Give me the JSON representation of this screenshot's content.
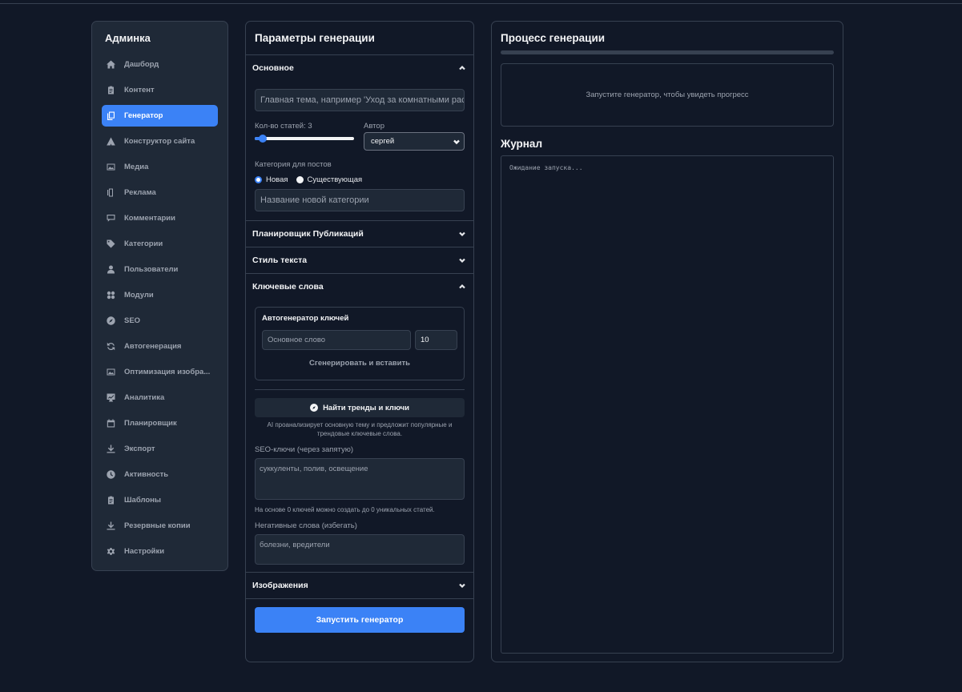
{
  "sidebar": {
    "title": "Админка",
    "items": [
      {
        "label": "Дашборд",
        "icon": "home-icon"
      },
      {
        "label": "Контент",
        "icon": "clipboard-icon"
      },
      {
        "label": "Генератор",
        "icon": "copy-icon",
        "active": true
      },
      {
        "label": "Конструктор сайта",
        "icon": "triangle-icon"
      },
      {
        "label": "Медиа",
        "icon": "image-icon"
      },
      {
        "label": "Реклама",
        "icon": "ad-icon"
      },
      {
        "label": "Комментарии",
        "icon": "comment-icon"
      },
      {
        "label": "Категории",
        "icon": "tag-icon"
      },
      {
        "label": "Пользователи",
        "icon": "user-icon"
      },
      {
        "label": "Модули",
        "icon": "grid-icon"
      },
      {
        "label": "SEO",
        "icon": "compass-icon"
      },
      {
        "label": "Автогенерация",
        "icon": "refresh-icon"
      },
      {
        "label": "Оптимизация изобра...",
        "icon": "image-icon"
      },
      {
        "label": "Аналитика",
        "icon": "chart-icon"
      },
      {
        "label": "Планировщик",
        "icon": "calendar-icon"
      },
      {
        "label": "Экспорт",
        "icon": "download-icon"
      },
      {
        "label": "Активность",
        "icon": "clock-icon"
      },
      {
        "label": "Шаблоны",
        "icon": "clipboard-icon"
      },
      {
        "label": "Резервные копии",
        "icon": "download-icon"
      },
      {
        "label": "Настройки",
        "icon": "gear-icon"
      }
    ]
  },
  "params": {
    "title": "Параметры генерации",
    "basic": {
      "header": "Основное",
      "topic_placeholder": "Главная тема, например 'Уход за комнатными растениями'",
      "articles_label": "Кол-во статей: 3",
      "articles_value": 3,
      "articles_min": 1,
      "articles_max": 50,
      "author_label": "Автор",
      "author_value": "сергей",
      "category_label": "Категория для постов",
      "radio_new": "Новая",
      "radio_existing": "Существующая",
      "new_category_placeholder": "Название новой категории"
    },
    "scheduler_header": "Планировщик Публикаций",
    "style_header": "Стиль текста",
    "keywords": {
      "header": "Ключевые слова",
      "autogen_title": "Автогенератор ключей",
      "base_word_placeholder": "Основное слово",
      "count_value": "10",
      "generate_button": "Сгенерировать и вставить",
      "trends_button": "Найти тренды и ключи",
      "trends_hint": "AI проанализирует основную тему и предложит популярные и трендовые ключевые слова.",
      "seo_label": "SEO-ключи (через запятую)",
      "seo_placeholder": "суккуленты, полив, освещение",
      "seo_hint": "На основе 0 ключей можно создать до 0 уникальных статей.",
      "negative_label": "Негативные слова (избегать)",
      "negative_placeholder": "болезни, вредители"
    },
    "images_header": "Изображения",
    "start_button": "Запустить генератор"
  },
  "process": {
    "title": "Процесс генерации",
    "progress": 0,
    "status_text": "Запустите генератор, чтобы увидеть прогресс",
    "journal_title": "Журнал",
    "journal_text": "Ожидание запуска..."
  },
  "colors": {
    "accent": "#3b82f6",
    "background": "#111827",
    "panel": "#1f2937"
  }
}
